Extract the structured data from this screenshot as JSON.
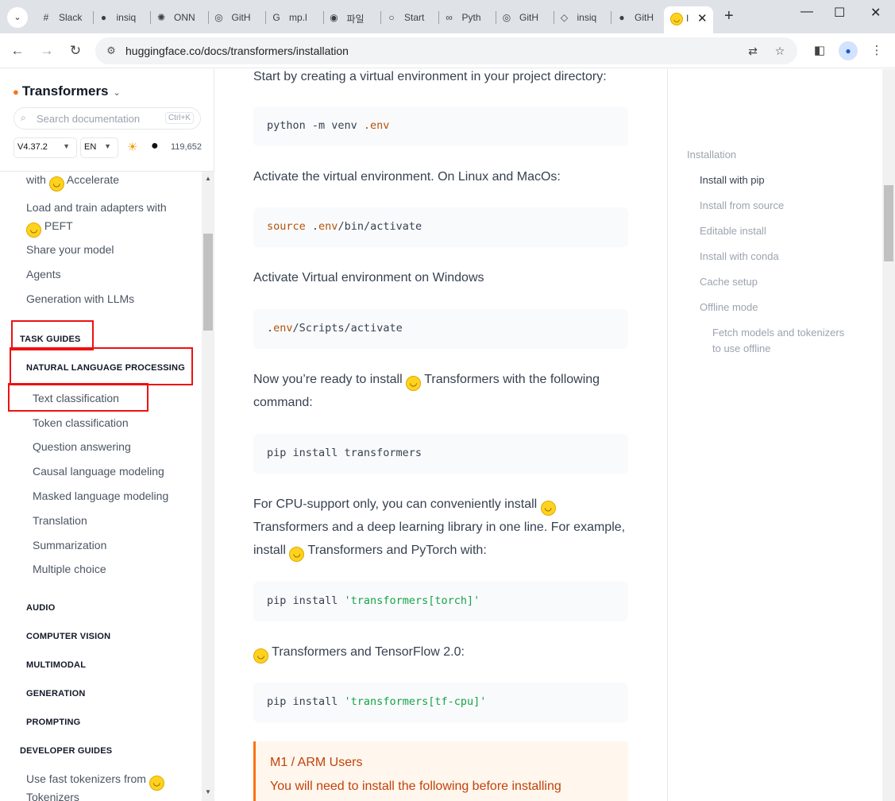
{
  "browser": {
    "tabs": [
      {
        "icon": "slack-icon",
        "glyph": "#",
        "label": "Slack"
      },
      {
        "icon": "github-icon",
        "glyph": "●",
        "label": "insiq"
      },
      {
        "icon": "onnx-icon",
        "glyph": "✺",
        "label": "ONN"
      },
      {
        "icon": "github-icon",
        "glyph": "◎",
        "label": "GitH"
      },
      {
        "icon": "google-icon",
        "glyph": "G",
        "label": "mp.l"
      },
      {
        "icon": "app-icon",
        "glyph": "◉",
        "label": "파일"
      },
      {
        "icon": "start-icon",
        "glyph": "○",
        "label": "Start"
      },
      {
        "icon": "python-icon",
        "glyph": "∞",
        "label": "Pyth"
      },
      {
        "icon": "github-icon",
        "glyph": "◎",
        "label": "GitH"
      },
      {
        "icon": "cube-icon",
        "glyph": "◇",
        "label": "insiq"
      },
      {
        "icon": "github-icon",
        "glyph": "●",
        "label": "GitH"
      }
    ],
    "active_tab": {
      "label": "I",
      "close": "✕"
    },
    "new_tab": "+",
    "window_controls": {
      "minimize": "—",
      "maximize": "☐",
      "close": "✕"
    },
    "url": "huggingface.co/docs/transformers/installation"
  },
  "sidebar": {
    "brand": "Transformers",
    "search_placeholder": "Search documentation",
    "search_shortcut": "Ctrl+K",
    "version": "V4.37.2",
    "language": "EN",
    "github_stars": "119,652",
    "items": [
      {
        "label": "with",
        "hug": true,
        "after": " Accelerate"
      },
      {
        "label": "Load and train adapters with"
      },
      {
        "label": "",
        "hug": true,
        "after": " PEFT"
      },
      {
        "label": "Share your model"
      },
      {
        "label": "Agents"
      },
      {
        "label": "Generation with LLMs"
      }
    ],
    "task_guides": "TASK GUIDES",
    "nlp": "NATURAL LANGUAGE PROCESSING",
    "nlp_items": [
      "Text classification",
      "Token classification",
      "Question answering",
      "Causal language modeling",
      "Masked language modeling",
      "Translation",
      "Summarization",
      "Multiple choice"
    ],
    "sections": [
      "AUDIO",
      "COMPUTER VISION",
      "MULTIMODAL",
      "GENERATION",
      "PROMPTING"
    ],
    "developer_guides": "DEVELOPER GUIDES",
    "dev_item_a": "Use fast tokenizers from",
    "dev_item_b": "Tokenizers"
  },
  "content": {
    "p1": "Start by creating a virtual environment in your project directory:",
    "code1": {
      "a": "python -m venv ",
      "b": ".env"
    },
    "p2": "Activate the virtual environment. On Linux and MacOs:",
    "code2": {
      "a": "source",
      "b": " .",
      "c": "env",
      "d": "/bin/activate"
    },
    "p3": "Activate Virtual environment on Windows",
    "code3": {
      "a": ".",
      "b": "env",
      "c": "/Scripts/activate"
    },
    "p4a": "Now you’re ready to install ",
    "p4b": " Transformers with the following",
    "p4c": "command:",
    "code4": "pip install transformers",
    "p5a": "For CPU-support only, you can conveniently install ",
    "p5b": "Transformers and a deep learning library in one line. For example,",
    "p5c": "install ",
    "p5d": " Transformers and PyTorch with:",
    "code5": {
      "a": "pip install ",
      "b": "'transformers[torch]'"
    },
    "p6": " Transformers and TensorFlow 2.0:",
    "code6": {
      "a": "pip install ",
      "b": "'transformers[tf-cpu]'"
    },
    "warn_title": "M1 / ARM Users",
    "warn_body": "You will need to install the following before installing"
  },
  "toc": {
    "title": "Installation",
    "items": [
      "Install with pip",
      "Install from source",
      "Editable install",
      "Install with conda",
      "Cache setup",
      "Offline mode"
    ],
    "sub_a": "Fetch models and tokenizers",
    "sub_b": "to use offline"
  },
  "colors": {
    "accent": "#f97316",
    "highlight": "#ee1111"
  }
}
